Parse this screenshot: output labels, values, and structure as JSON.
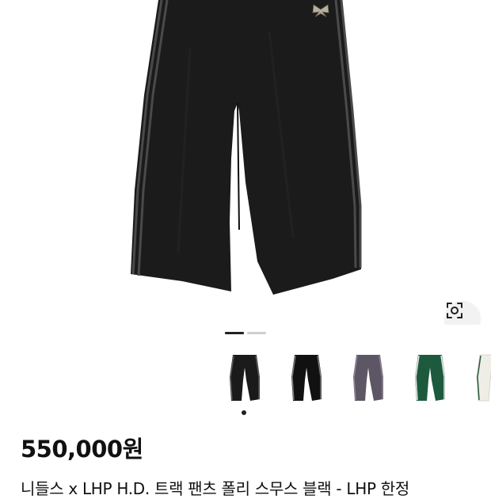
{
  "product": {
    "price": "550,000원",
    "title": "니들스 x LHP H.D. 트랙 팬츠 폴리 스무스 블랙 - LHP 한정"
  },
  "gallery": {
    "active_index": 0,
    "total_images": 2
  },
  "thumbnails": [
    {
      "name": "thumb-black-1",
      "color": "#1a1a1a",
      "stripe": "#5a5a5a",
      "selected": true
    },
    {
      "name": "thumb-black-2",
      "color": "#111111",
      "stripe": "#777777",
      "selected": false
    },
    {
      "name": "thumb-purple",
      "color": "#5d5665",
      "stripe": "#8a8294",
      "selected": false
    },
    {
      "name": "thumb-green",
      "color": "#1d5a3d",
      "stripe": "#e8e8e8",
      "selected": false
    },
    {
      "name": "thumb-ivory",
      "color": "#efeee6",
      "stripe": "#2b5c3f",
      "selected": false
    }
  ],
  "colors": {
    "pants": "#1b1b1b",
    "stripe": "#4a4a4a",
    "text": "#111111"
  }
}
